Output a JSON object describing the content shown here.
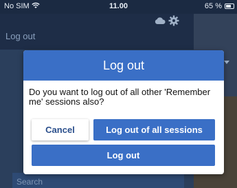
{
  "status_bar": {
    "carrier": "No SIM",
    "time": "11.00",
    "battery": "65 %"
  },
  "header": {
    "title": "Log out",
    "icons": [
      "cloud-icon",
      "gear-icon"
    ]
  },
  "search": {
    "placeholder": "Search"
  },
  "dialog": {
    "title": "Log out",
    "message": "Do you want to log out of all other 'Remember me' sessions also?",
    "cancel_label": "Cancel",
    "logout_all_label": "Log out of all sessions",
    "logout_label": "Log out"
  },
  "colors": {
    "accent": "#3a6fc6",
    "background": "#1d2c44"
  }
}
